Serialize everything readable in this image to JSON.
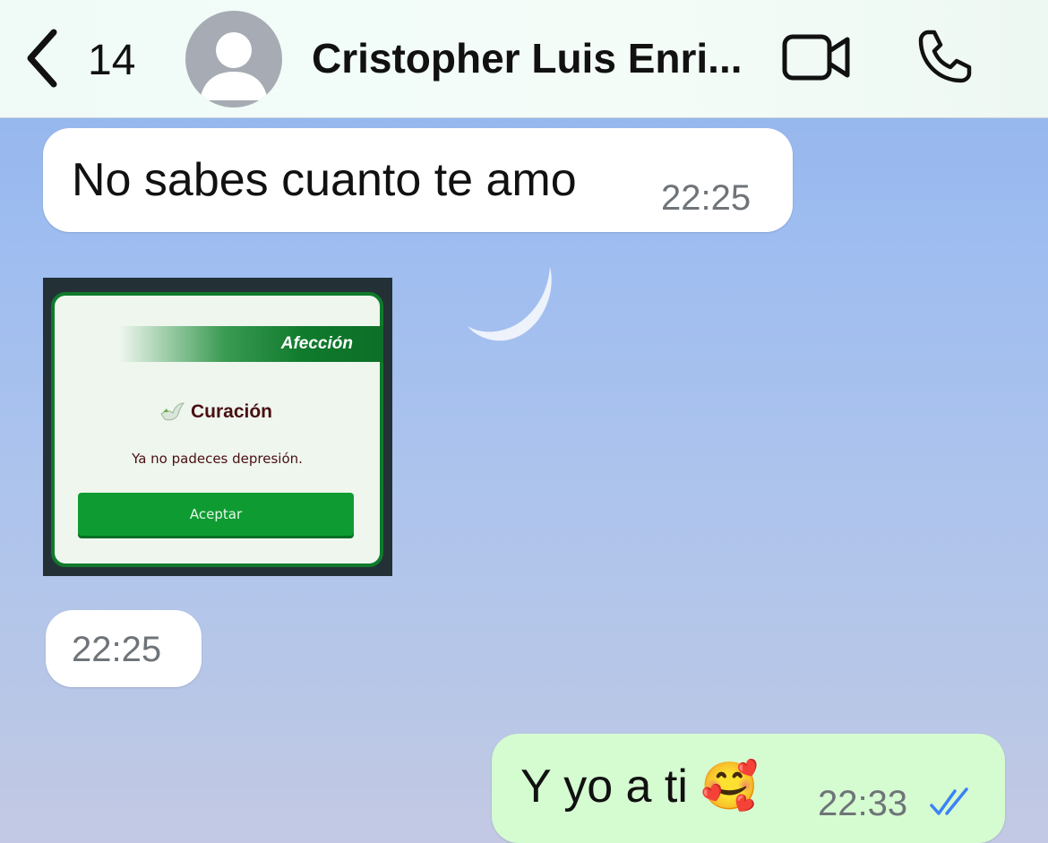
{
  "header": {
    "back_count": "14",
    "contact_name": "Cristopher Luis Enri...",
    "icons": [
      "chevron-left-icon",
      "avatar-placeholder-icon",
      "video-camera-icon",
      "phone-icon"
    ]
  },
  "messages": [
    {
      "direction": "incoming",
      "type": "text",
      "text": "No sabes cuanto te amo",
      "time": "22:25"
    },
    {
      "direction": "incoming",
      "type": "image",
      "image": {
        "banner": "Afección",
        "title": "Curación",
        "body": "Ya no padeces depresión.",
        "button": "Aceptar"
      }
    },
    {
      "direction": "incoming",
      "type": "time",
      "time": "22:25"
    },
    {
      "direction": "outgoing",
      "type": "text",
      "text": "Y yo a ti 🥰",
      "time": "22:33",
      "status": "read"
    }
  ],
  "colors": {
    "incoming_bubble": "#ffffff",
    "outgoing_bubble": "#d5fbd0",
    "read_ticks": "#3b82f6",
    "card_green": "#0e9c32"
  }
}
